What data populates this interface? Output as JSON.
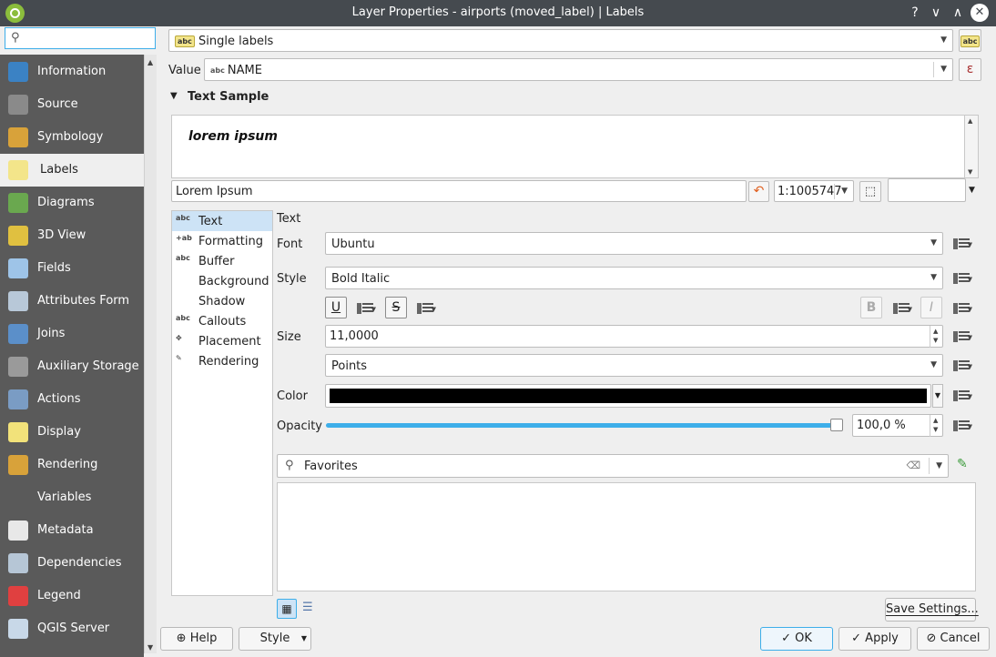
{
  "window": {
    "title": "Layer Properties - airports (moved_label) | Labels",
    "help_glyph": "?",
    "minimize_glyph": "∨",
    "maximize_glyph": "∧",
    "close_glyph": "✕"
  },
  "sidebar": {
    "search_placeholder": "",
    "items": [
      {
        "label": "Information",
        "icon": "information-icon",
        "color": "#3b82c4"
      },
      {
        "label": "Source",
        "icon": "source-icon",
        "color": "#8a8a8a"
      },
      {
        "label": "Symbology",
        "icon": "symbology-icon",
        "color": "#d8a23a"
      },
      {
        "label": "Labels",
        "icon": "labels-icon",
        "color": "#f3e58a",
        "selected": true
      },
      {
        "label": "Diagrams",
        "icon": "diagrams-icon",
        "color": "#6aa84f"
      },
      {
        "label": "3D View",
        "icon": "3d-view-icon",
        "color": "#e0c040"
      },
      {
        "label": "Fields",
        "icon": "fields-icon",
        "color": "#9ec4e8"
      },
      {
        "label": "Attributes Form",
        "icon": "attributes-form-icon",
        "color": "#b8c8d8"
      },
      {
        "label": "Joins",
        "icon": "joins-icon",
        "color": "#5b8fc9"
      },
      {
        "label": "Auxiliary Storage",
        "icon": "auxiliary-storage-icon",
        "color": "#9a9a9a"
      },
      {
        "label": "Actions",
        "icon": "actions-icon",
        "color": "#7a9cc4"
      },
      {
        "label": "Display",
        "icon": "display-icon",
        "color": "#f2e27a"
      },
      {
        "label": "Rendering",
        "icon": "rendering-icon",
        "color": "#d8a23a"
      },
      {
        "label": "Variables",
        "icon": "variables-icon",
        "color": "#5a5a5a"
      },
      {
        "label": "Metadata",
        "icon": "metadata-icon",
        "color": "#e8e8e8"
      },
      {
        "label": "Dependencies",
        "icon": "dependencies-icon",
        "color": "#b6c6d6"
      },
      {
        "label": "Legend",
        "icon": "legend-icon",
        "color": "#e04040"
      },
      {
        "label": "QGIS Server",
        "icon": "qgis-server-icon",
        "color": "#c8d8e8"
      }
    ]
  },
  "labels": {
    "mode": "Single labels",
    "value_label": "Value",
    "value_field": "NAME",
    "expression_glyph": "ε",
    "text_sample_header": "Text Sample",
    "sample_text": "lorem ipsum",
    "sample_input": "Lorem Ipsum",
    "scale": "1:1005747",
    "tabs": [
      {
        "label": "Text",
        "icon": "text-tab-icon",
        "glyph": "abc",
        "selected": true
      },
      {
        "label": "Formatting",
        "icon": "formatting-tab-icon",
        "glyph": "+ab"
      },
      {
        "label": "Buffer",
        "icon": "buffer-tab-icon",
        "glyph": "abc"
      },
      {
        "label": "Background",
        "icon": "background-tab-icon",
        "glyph": ""
      },
      {
        "label": "Shadow",
        "icon": "shadow-tab-icon",
        "glyph": ""
      },
      {
        "label": "Callouts",
        "icon": "callouts-tab-icon",
        "glyph": "abc"
      },
      {
        "label": "Placement",
        "icon": "placement-tab-icon",
        "glyph": "✥"
      },
      {
        "label": "Rendering",
        "icon": "rendering-tab-icon",
        "glyph": "✎"
      }
    ]
  },
  "text": {
    "section_title": "Text",
    "font_label": "Font",
    "font_value": "Ubuntu",
    "style_label": "Style",
    "style_value": "Bold Italic",
    "underline_glyph": "U",
    "strike_glyph": "S",
    "bold_glyph": "B",
    "italic_glyph": "I",
    "size_label": "Size",
    "size_value": "11,0000",
    "unit_value": "Points",
    "color_label": "Color",
    "color_value": "#000000",
    "opacity_label": "Opacity",
    "opacity_value": "100,0 %",
    "opacity_level": 1.0
  },
  "favorites": {
    "value": "Favorites"
  },
  "footer": {
    "help": "Help",
    "style": "Style",
    "save_settings": "Save Settings...",
    "ok": "OK",
    "apply": "Apply",
    "cancel": "Cancel"
  }
}
